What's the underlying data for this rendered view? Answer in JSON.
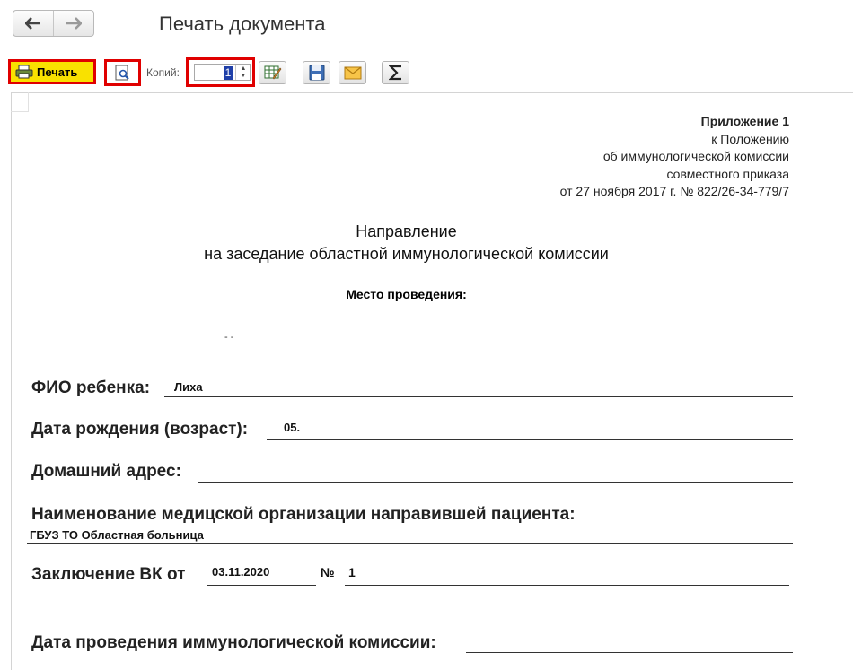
{
  "window": {
    "title": "Печать документа",
    "back_icon": "arrow-left-icon",
    "forward_icon": "arrow-right-icon"
  },
  "toolbar": {
    "print_label": "Печать",
    "copies_label": "Копий:",
    "copies_value": "1",
    "highlight_color": "#e00000",
    "print_bg": "#f9e100"
  },
  "document": {
    "appendix": {
      "line1": "Приложение 1",
      "line2": "к Положению",
      "line3": "об иммунологической комиссии",
      "line4": "совместного приказа",
      "line5": "от 27 ноября 2017 г. № 822/26-34-779/7"
    },
    "title_line1": "Направление",
    "title_line2": "на заседание областной иммунологической комиссии",
    "place_label": "Место проведения:",
    "mark": "- -",
    "fields": {
      "fio_label": "ФИО ребенка:",
      "fio_value": "Лиха",
      "birth_label": "Дата рождения (возраст):",
      "birth_value": "05.",
      "address_label": "Домашний адрес:",
      "org_label": "Наименование медицской организации направившей пациента:",
      "org_value": "ГБУЗ ТО Областная больница",
      "conclusion_label": "Заключение ВК от",
      "conclusion_date": "03.11.2020",
      "number_label": "№",
      "number_value": "1",
      "commission_date_label": "Дата проведения иммунологической комиссии:"
    }
  }
}
